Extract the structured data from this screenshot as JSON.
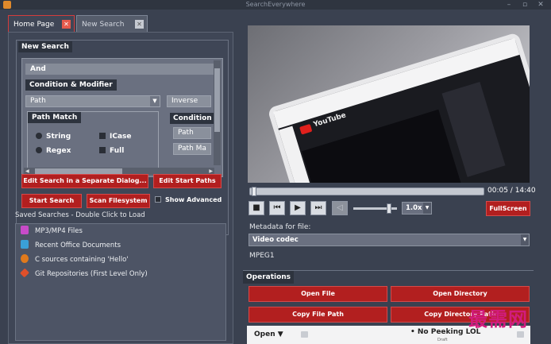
{
  "window": {
    "title": "SearchEverywhere"
  },
  "tabs": [
    {
      "label": "Home Page",
      "active": true
    },
    {
      "label": "New Search",
      "active": false
    }
  ],
  "new_search": {
    "section_label": "New Search",
    "and_label": "And",
    "condition_modifier_label": "Condition & Modifier",
    "field_combo": "Path",
    "inverse_combo": "Inverse",
    "path_match_label": "Path Match",
    "condition_label": "Condition",
    "condition_combo": "Path",
    "condition_combo2": "Path Ma",
    "options": {
      "string": "String",
      "icase": "ICase",
      "regex": "Regex",
      "full": "Full"
    },
    "buttons": {
      "edit_separate": "Edit Search in a Separate Dialog...",
      "edit_start_paths": "Edit Start Paths",
      "start_search": "Start Search",
      "scan_filesystem": "Scan Filesystem",
      "show_advanced": "Show Advanced"
    }
  },
  "saved_searches": {
    "title": "Saved Searches - Double Click to Load",
    "items": [
      {
        "label": "MP3/MP4 Files",
        "icon": "music-file-icon",
        "color": "#c84bc8"
      },
      {
        "label": "Recent Office Documents",
        "icon": "document-icon",
        "color": "#3aa0d8"
      },
      {
        "label": "C sources containing 'Hello'",
        "icon": "c-source-icon",
        "color": "#e07a1c"
      },
      {
        "label": "Git Repositories (First Level Only)",
        "icon": "git-icon",
        "color": "#e0502a"
      }
    ]
  },
  "player": {
    "video_text": {
      "youtube": "YouTube"
    },
    "time": "00:05 / 14:40",
    "progress": 0.006,
    "volume": 0.85,
    "speed": "1.0x",
    "fullscreen": "FullScreen"
  },
  "metadata": {
    "label": "Metadata for file:",
    "selected": "Video codec",
    "value": "MPEG1"
  },
  "operations": {
    "label": "Operations",
    "open_file": "Open File",
    "open_directory": "Open Directory",
    "copy_file_path": "Copy File Path",
    "copy_directory_path": "Copy Directory Path"
  },
  "open_panel": {
    "open_label": "Open",
    "caret": "▼",
    "peek_text": "• No Peeking LOL",
    "sub_text": "Draft"
  },
  "watermark": "最需网",
  "colors": {
    "accent_red": "#b21f1f",
    "panel": "#3f4656",
    "background": "#3a4150"
  }
}
